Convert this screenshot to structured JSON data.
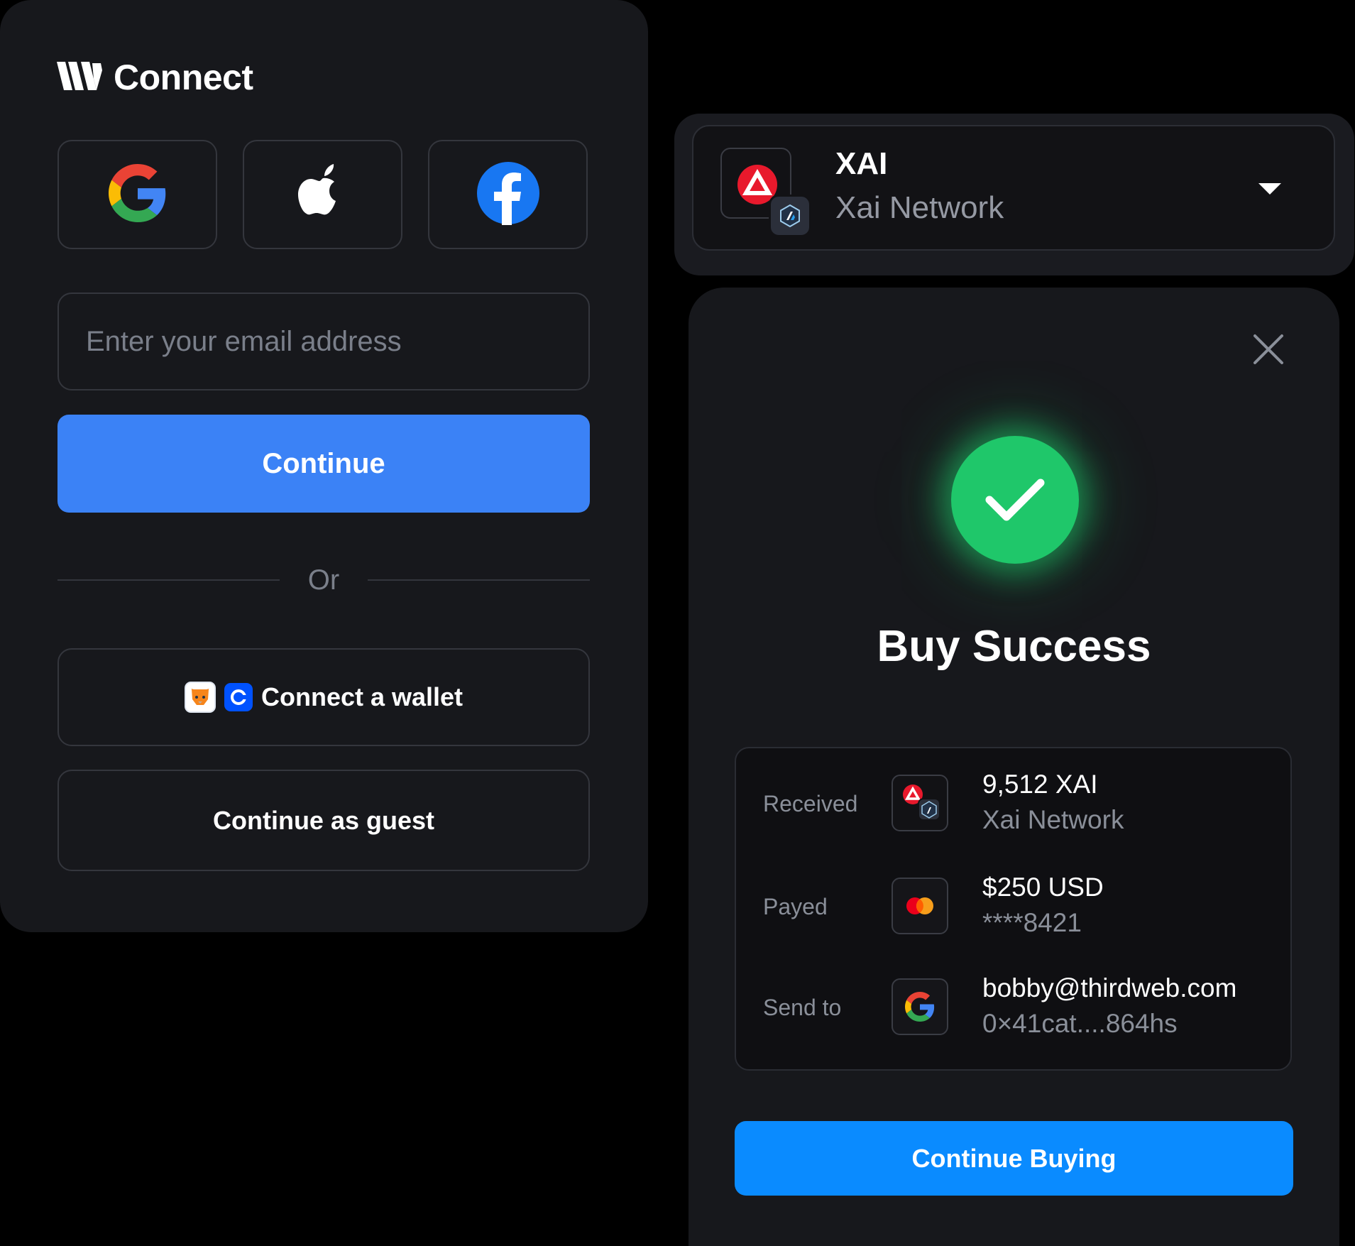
{
  "connect": {
    "title": "Connect",
    "social_buttons": [
      {
        "icon": "google-icon"
      },
      {
        "icon": "apple-icon"
      },
      {
        "icon": "facebook-icon"
      }
    ],
    "email": {
      "placeholder": "Enter your email address",
      "value": ""
    },
    "continue_label": "Continue",
    "divider_label": "Or",
    "wallet_label": "Connect a wallet",
    "guest_label": "Continue as guest",
    "colors": {
      "card_bg": "#17181c",
      "primary_button": "#3b82f6"
    }
  },
  "network": {
    "symbol": "XAI",
    "name": "Xai Network",
    "icon": "xai-chain-icon"
  },
  "success": {
    "title": "Buy Success",
    "rows": [
      {
        "label": "Received",
        "primary": "9,512 XAI",
        "secondary": "Xai Network",
        "icon": "xai-chain-icon"
      },
      {
        "label": "Payed",
        "primary": "$250 USD",
        "secondary": "****8421",
        "icon": "mastercard-icon"
      },
      {
        "label": "Send to",
        "primary": "bobby@thirdweb.com",
        "secondary": "0×41cat....864hs",
        "icon": "google-icon"
      }
    ],
    "button_label": "Continue Buying",
    "colors": {
      "success": "#1fc76a",
      "button": "#0a8bff"
    }
  }
}
